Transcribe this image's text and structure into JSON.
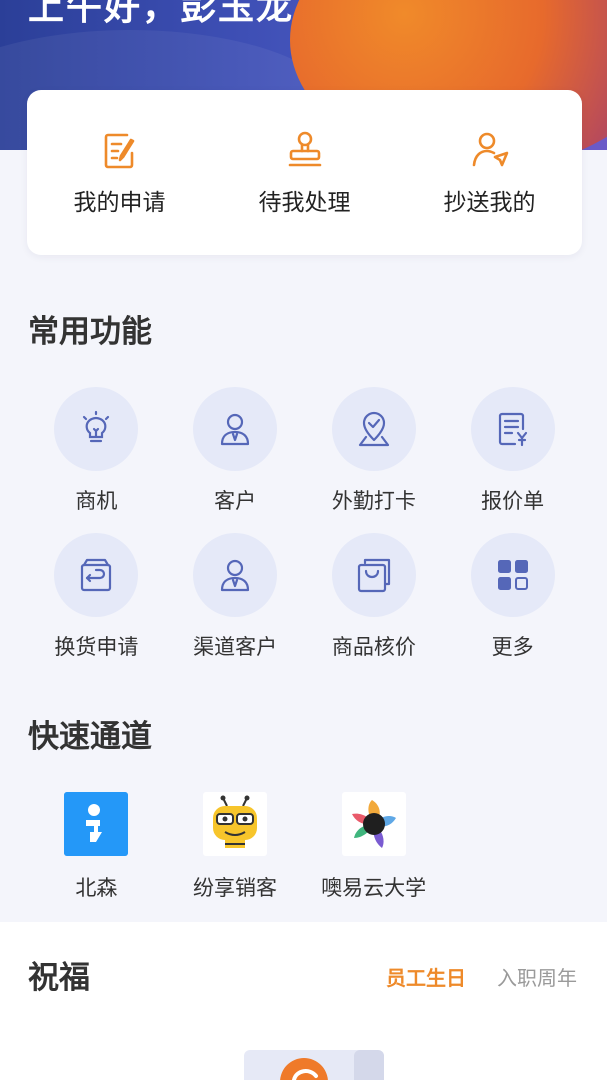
{
  "header": {
    "greeting": "上午好，彭玉龙"
  },
  "approvals": [
    {
      "label": "我的申请",
      "icon": "document-edit-icon"
    },
    {
      "label": "待我处理",
      "icon": "stamp-icon"
    },
    {
      "label": "抄送我的",
      "icon": "user-send-icon"
    }
  ],
  "common_functions": {
    "title": "常用功能",
    "items": [
      {
        "label": "商机",
        "icon": "lightbulb-icon"
      },
      {
        "label": "客户",
        "icon": "person-icon"
      },
      {
        "label": "外勤打卡",
        "icon": "location-check-icon"
      },
      {
        "label": "报价单",
        "icon": "quote-document-icon"
      },
      {
        "label": "换货申请",
        "icon": "exchange-box-icon"
      },
      {
        "label": "渠道客户",
        "icon": "person-icon"
      },
      {
        "label": "商品核价",
        "icon": "product-price-icon"
      },
      {
        "label": "更多",
        "icon": "grid-more-icon"
      }
    ]
  },
  "quick_access": {
    "title": "快速通道",
    "items": [
      {
        "label": "北森",
        "icon": "beisen-logo"
      },
      {
        "label": "纷享销客",
        "icon": "bee-logo"
      },
      {
        "label": "噢易云大学",
        "icon": "colorful-petal-logo"
      }
    ]
  },
  "blessing": {
    "title": "祝福",
    "tabs": [
      "员工生日",
      "入职周年"
    ],
    "active_tab": "员工生日"
  },
  "colors": {
    "accent_orange": "#ee8a2a",
    "icon_blue": "#5567b8",
    "icon_circle_bg": "#e5e9f8",
    "hero_blue": "#3e4fb5"
  }
}
